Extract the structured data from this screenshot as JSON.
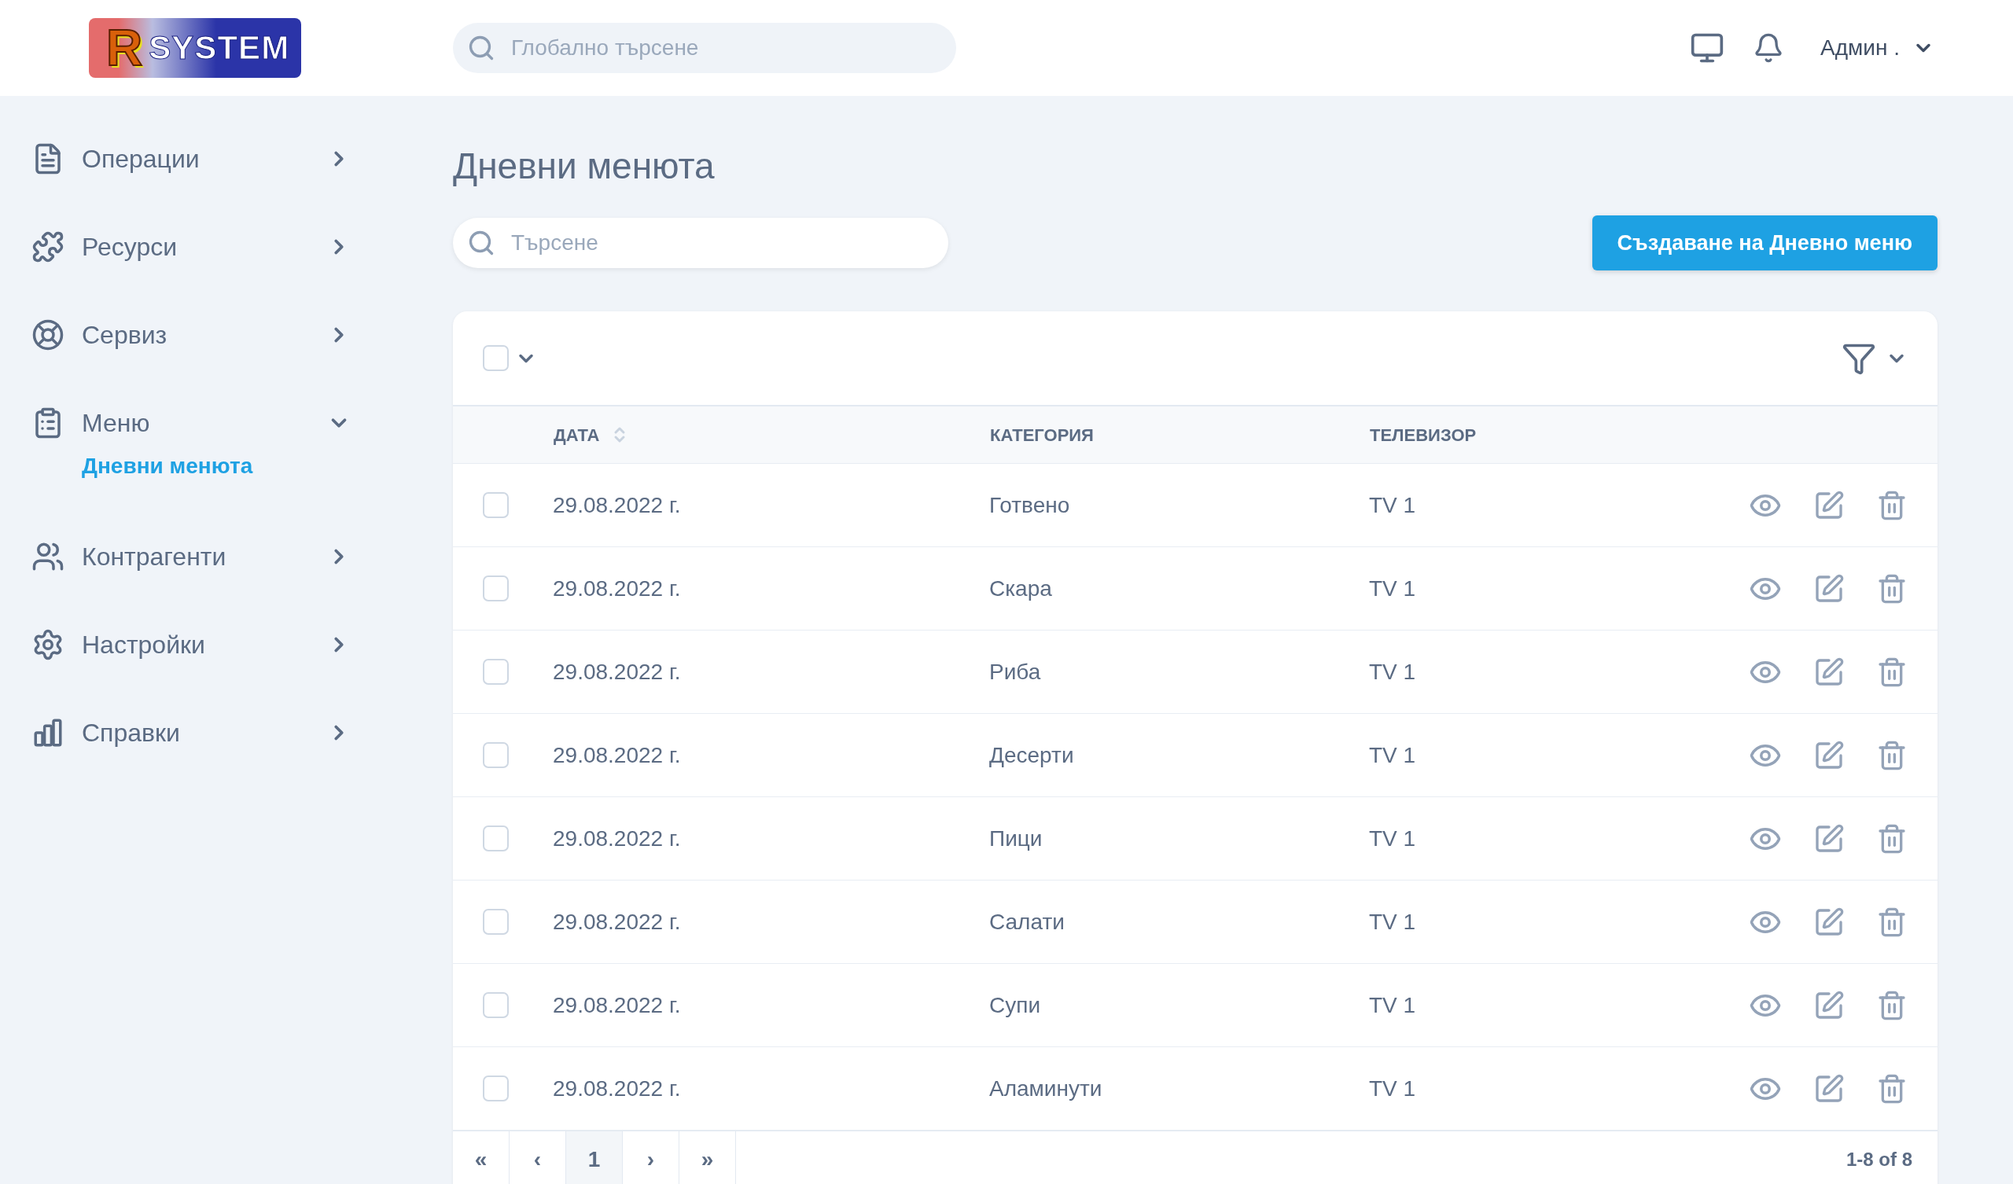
{
  "header": {
    "logo": {
      "letter": "R",
      "word": "SYSTEM"
    },
    "search": {
      "placeholder": "Глобално търсене"
    },
    "user": "Админ ."
  },
  "sidebar": {
    "items": [
      {
        "label": "Операции",
        "expanded": false
      },
      {
        "label": "Ресурси",
        "expanded": false
      },
      {
        "label": "Сервиз",
        "expanded": false
      },
      {
        "label": "Меню",
        "expanded": true,
        "children": [
          {
            "label": "Дневни менюта",
            "selected": true
          }
        ]
      },
      {
        "label": "Контрагенти",
        "expanded": false
      },
      {
        "label": "Настройки",
        "expanded": false
      },
      {
        "label": "Справки",
        "expanded": false
      }
    ]
  },
  "page": {
    "title": "Дневни менюта",
    "search": {
      "placeholder": "Търсене"
    },
    "create_button": "Създаване на Дневно меню"
  },
  "table": {
    "select_all": {
      "checked": false
    },
    "columns": [
      {
        "label": "ДАТА",
        "sortable": true
      },
      {
        "label": "КАТЕГОРИЯ",
        "sortable": false
      },
      {
        "label": "ТЕЛЕВИЗОР",
        "sortable": false
      }
    ],
    "rows": [
      {
        "checked": false,
        "cells": [
          "29.08.2022 г.",
          "Готвено",
          "TV 1"
        ]
      },
      {
        "checked": false,
        "cells": [
          "29.08.2022 г.",
          "Скара",
          "TV 1"
        ]
      },
      {
        "checked": false,
        "cells": [
          "29.08.2022 г.",
          "Риба",
          "TV 1"
        ]
      },
      {
        "checked": false,
        "cells": [
          "29.08.2022 г.",
          "Десерти",
          "TV 1"
        ]
      },
      {
        "checked": false,
        "cells": [
          "29.08.2022 г.",
          "Пици",
          "TV 1"
        ]
      },
      {
        "checked": false,
        "cells": [
          "29.08.2022 г.",
          "Салати",
          "TV 1"
        ]
      },
      {
        "checked": false,
        "cells": [
          "29.08.2022 г.",
          "Супи",
          "TV 1"
        ]
      },
      {
        "checked": false,
        "cells": [
          "29.08.2022 г.",
          "Аламинути",
          "TV 1"
        ]
      }
    ]
  },
  "pagination": {
    "buttons": [
      {
        "label": "«",
        "selected": false
      },
      {
        "label": "‹",
        "selected": false
      },
      {
        "label": "1",
        "selected": true
      },
      {
        "label": "›",
        "selected": false
      },
      {
        "label": "»",
        "selected": false
      }
    ],
    "range": "1-8 of 8"
  }
}
